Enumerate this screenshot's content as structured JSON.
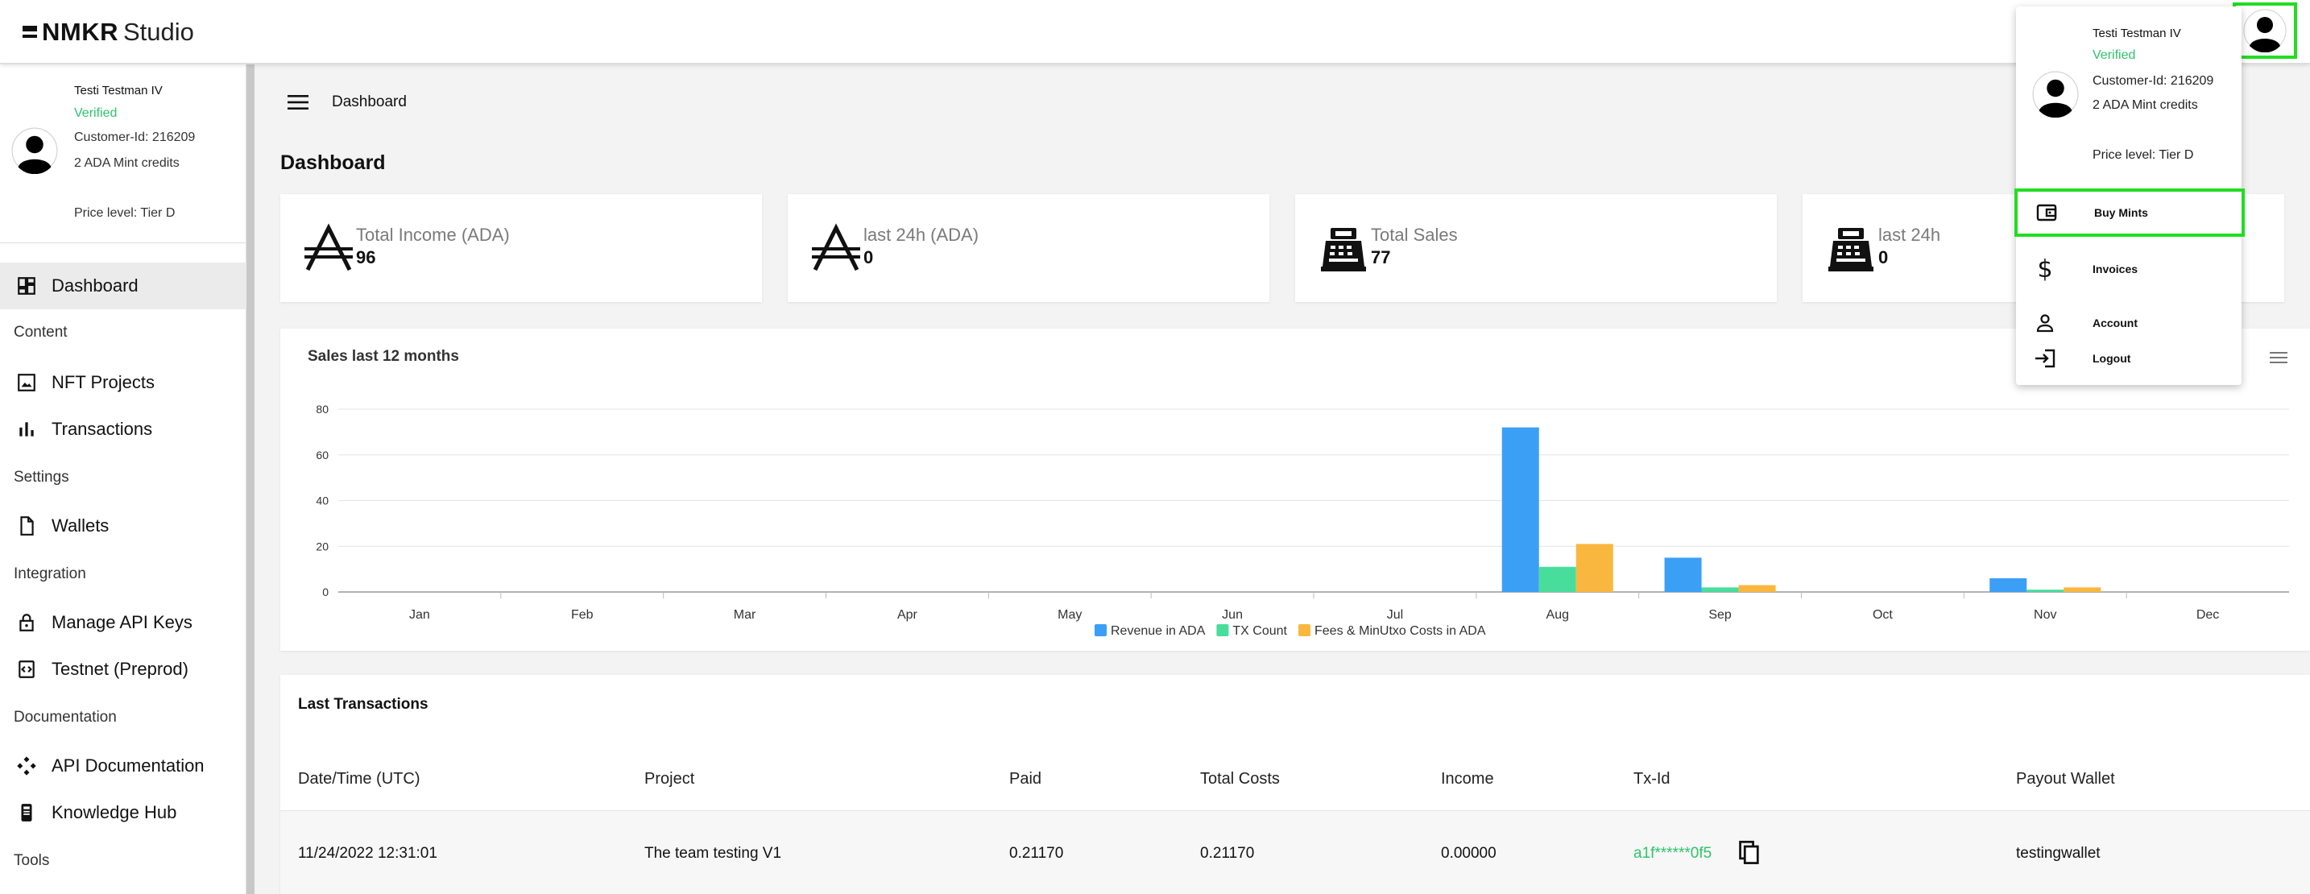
{
  "app": {
    "logo_bold": "NMKR",
    "logo_light": "Studio"
  },
  "user": {
    "name": "Testi Testman IV",
    "status": "Verified",
    "customer_id": "Customer-Id: 216209",
    "mint_credits": "2 ADA Mint credits",
    "price_level": "Price level: Tier D"
  },
  "sidebar": {
    "dashboard": "Dashboard",
    "section_content": "Content",
    "nft_projects": "NFT Projects",
    "transactions": "Transactions",
    "section_settings": "Settings",
    "wallets": "Wallets",
    "section_integration": "Integration",
    "manage_api_keys": "Manage API Keys",
    "testnet": "Testnet (Preprod)",
    "section_documentation": "Documentation",
    "api_documentation": "API Documentation",
    "knowledge_hub": "Knowledge Hub",
    "section_tools": "Tools"
  },
  "header": {
    "breadcrumb": "Dashboard",
    "page_title": "Dashboard"
  },
  "stats": [
    {
      "label": "Total Income (ADA)",
      "value": "96",
      "icon": "ada-icon"
    },
    {
      "label": "last 24h (ADA)",
      "value": "0",
      "icon": "ada-icon"
    },
    {
      "label": "Total Sales",
      "value": "77",
      "icon": "cash-register-icon"
    },
    {
      "label": "last 24h",
      "value": "0",
      "icon": "cash-register-icon"
    }
  ],
  "chart_data": {
    "type": "bar",
    "title": "Sales last 12 months",
    "categories": [
      "Jan",
      "Feb",
      "Mar",
      "Apr",
      "May",
      "Jun",
      "Jul",
      "Aug",
      "Sep",
      "Oct",
      "Nov",
      "Dec"
    ],
    "series": [
      {
        "name": "Revenue in ADA",
        "color": "#3b9ff6",
        "values": [
          0,
          0,
          0,
          0,
          0,
          0,
          0,
          72,
          15,
          0,
          6,
          0
        ]
      },
      {
        "name": "TX Count",
        "color": "#49dd9c",
        "values": [
          0,
          0,
          0,
          0,
          0,
          0,
          0,
          11,
          2,
          0,
          1,
          0
        ]
      },
      {
        "name": "Fees & MinUtxo Costs in ADA",
        "color": "#fab73f",
        "values": [
          0,
          0,
          0,
          0,
          0,
          0,
          0,
          21,
          3,
          0,
          2,
          0
        ]
      }
    ],
    "yticks": [
      0,
      20,
      40,
      60,
      80
    ],
    "ylim": [
      0,
      80
    ],
    "grid": true,
    "legend": "bottom"
  },
  "transactions": {
    "title": "Last Transactions",
    "columns": [
      "Date/Time (UTC)",
      "Project",
      "Paid",
      "Total Costs",
      "Income",
      "Tx-Id",
      "Payout Wallet"
    ],
    "rows": [
      [
        "11/24/2022 12:31:01",
        "The team testing V1",
        "0.21170",
        "0.21170",
        "0.00000",
        "a1f******0f5",
        "testingwallet"
      ]
    ]
  },
  "dropdown": {
    "items": [
      {
        "label": "Buy Mints",
        "icon": "wallet-icon"
      },
      {
        "label": "Invoices",
        "icon": "dollar-icon"
      },
      {
        "label": "Account",
        "icon": "person-icon"
      },
      {
        "label": "Logout",
        "icon": "logout-icon"
      }
    ]
  }
}
